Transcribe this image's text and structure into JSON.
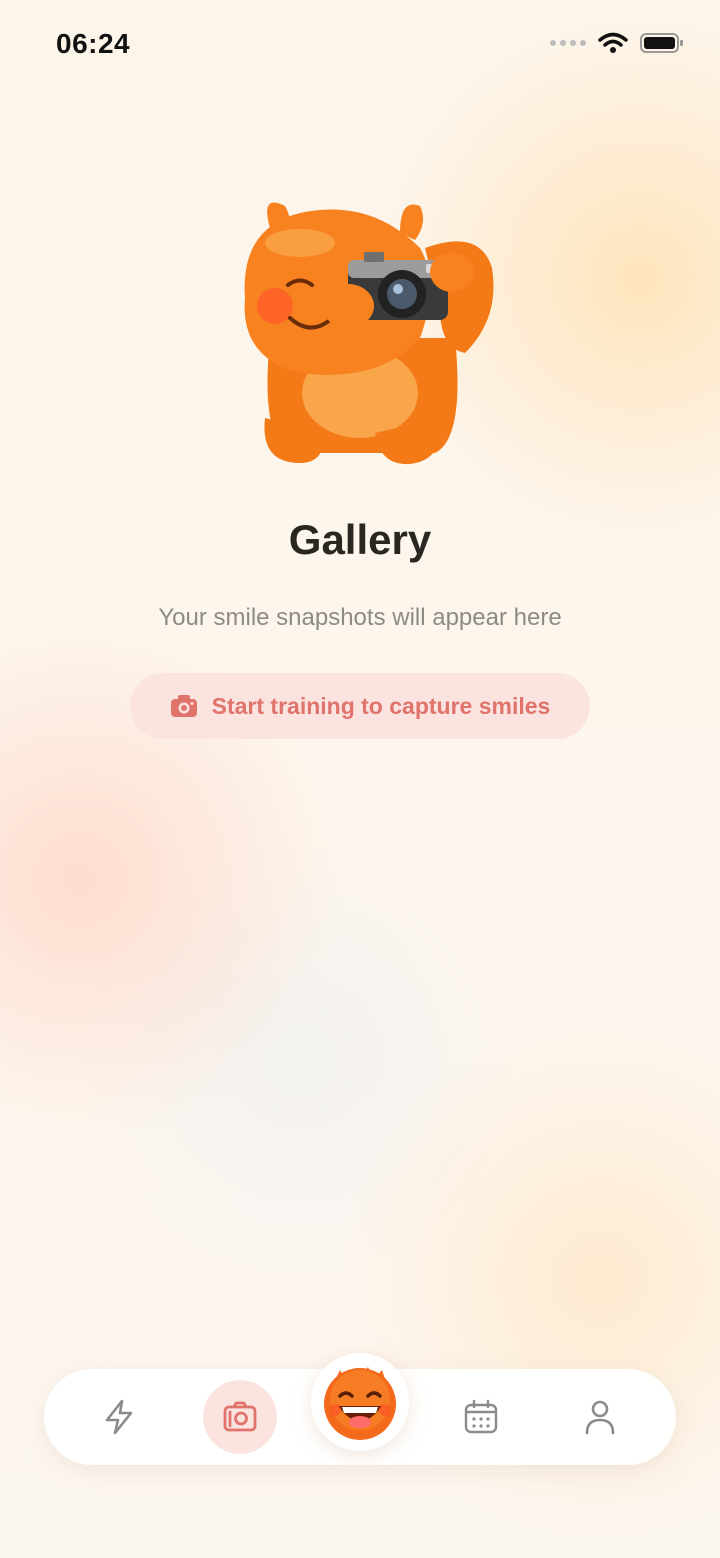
{
  "status_bar": {
    "time": "06:24",
    "icons": [
      "signal-dots-icon",
      "wifi-icon",
      "battery-icon"
    ]
  },
  "hero": {
    "illustration": "orange-monster-with-camera",
    "title": "Gallery",
    "subtitle": "Your smile snapshots will appear here"
  },
  "cta": {
    "icon": "camera-icon",
    "label": "Start training to capture smiles"
  },
  "tabbar": {
    "items": [
      {
        "icon": "lightning-icon",
        "active": false
      },
      {
        "icon": "gallery-camera-icon",
        "active": true
      },
      {
        "icon": "smiling-monster-avatar",
        "active": false
      },
      {
        "icon": "calendar-icon",
        "active": false
      },
      {
        "icon": "person-icon",
        "active": false
      }
    ]
  },
  "colors": {
    "accent": "#e0736c",
    "accent_soft": "#fbe4df",
    "mascot": "#f7821f",
    "title": "#2a2622",
    "subtitle": "#8e8a86"
  }
}
